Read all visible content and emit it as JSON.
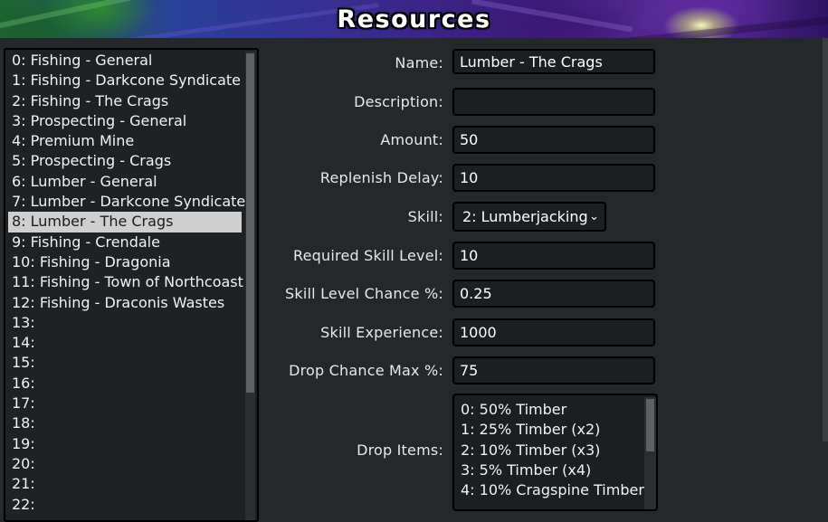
{
  "header": {
    "title": "Resources"
  },
  "resource_list": {
    "items": [
      "0: Fishing - General",
      "1: Fishing - Darkcone Syndicate",
      "2: Fishing - The Crags",
      "3: Prospecting - General",
      "4: Premium Mine",
      "5: Prospecting - Crags",
      "6: Lumber - General",
      "7: Lumber - Darkcone Syndicate",
      "8: Lumber - The Crags",
      "9: Fishing - Crendale",
      "10: Fishing - Dragonia",
      "11: Fishing - Town of Northcoast",
      "12: Fishing - Draconis Wastes",
      "13:",
      "14:",
      "15:",
      "16:",
      "17:",
      "18:",
      "19:",
      "20:",
      "21:",
      "22:"
    ],
    "selected_index": 8
  },
  "form": {
    "name": {
      "label": "Name:",
      "value": "Lumber - The Crags"
    },
    "description": {
      "label": "Description:",
      "value": ""
    },
    "amount": {
      "label": "Amount:",
      "value": "50"
    },
    "replenish_delay": {
      "label": "Replenish Delay:",
      "value": "10"
    },
    "skill": {
      "label": "Skill:",
      "value": "2: Lumberjacking"
    },
    "required_skill_level": {
      "label": "Required Skill Level:",
      "value": "10"
    },
    "skill_level_chance": {
      "label": "Skill Level Chance %:",
      "value": "0.25"
    },
    "skill_experience": {
      "label": "Skill Experience:",
      "value": "1000"
    },
    "drop_chance_max": {
      "label": "Drop Chance Max %:",
      "value": "75"
    },
    "drop_items": {
      "label": "Drop Items:",
      "items": [
        "0: 50% Timber",
        "1: 25% Timber (x2)",
        "2: 10% Timber (x3)",
        "3: 5% Timber (x4)",
        "4: 10% Cragspine Timber"
      ]
    }
  },
  "icons": {
    "select_chevron": "chevron-down-icon"
  }
}
